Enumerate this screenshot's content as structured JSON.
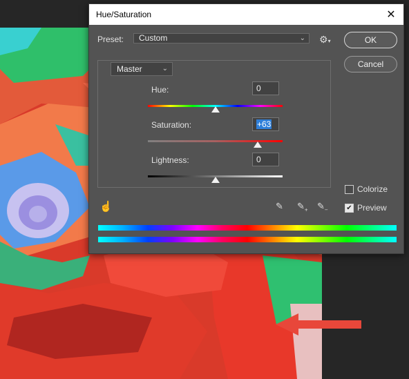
{
  "dialog": {
    "title": "Hue/Saturation",
    "close_glyph": "✕",
    "preset_label": "Preset:",
    "preset_value": "Custom",
    "ok_label": "OK",
    "cancel_label": "Cancel",
    "channel": "Master",
    "hue": {
      "label": "Hue:",
      "value": "0"
    },
    "saturation": {
      "label": "Saturation:",
      "value": "+63"
    },
    "lightness": {
      "label": "Lightness:",
      "value": "0"
    },
    "colorize": {
      "label": "Colorize",
      "checked": false
    },
    "preview": {
      "label": "Preview",
      "checked": true
    }
  },
  "sliders": {
    "hue_level": 0.5,
    "saturation_level": 0.815,
    "lightness_level": 0.5
  },
  "colors": {
    "dialog_bg": "#535353",
    "annotation_arrow": "#e8473a",
    "selection": "#2f7fd9"
  }
}
